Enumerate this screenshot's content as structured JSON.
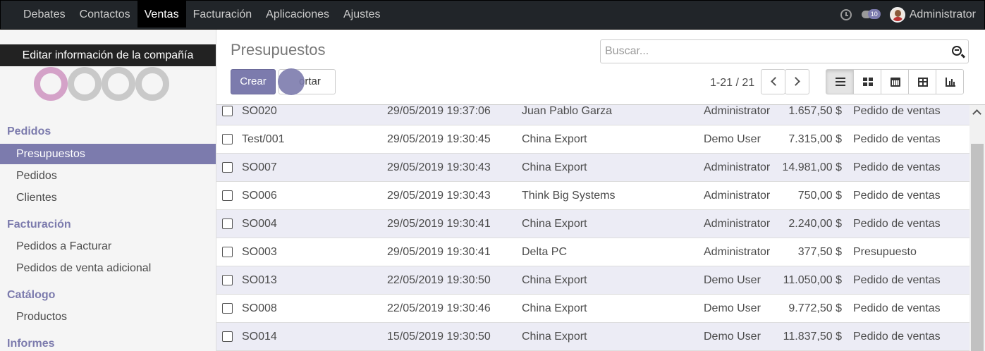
{
  "topbar": {
    "menu": [
      "Debates",
      "Contactos",
      "Ventas",
      "Facturación",
      "Aplicaciones",
      "Ajustes"
    ],
    "active_menu": "Ventas",
    "chat_badge": "10",
    "user_name": "Administrator"
  },
  "sidebar": {
    "tooltip": "Editar información de la compañía",
    "sections": [
      {
        "title": "Pedidos",
        "items": [
          "Presupuestos",
          "Pedidos",
          "Clientes"
        ]
      },
      {
        "title": "Facturación",
        "items": [
          "Pedidos a Facturar",
          "Pedidos de venta adicional"
        ]
      },
      {
        "title": "Catálogo",
        "items": [
          "Productos"
        ]
      },
      {
        "title": "Informes",
        "items": []
      }
    ],
    "active_item": "Presupuestos"
  },
  "control": {
    "title": "Presupuestos",
    "search_placeholder": "Buscar...",
    "create_label": "Crear",
    "import_label": "Importar",
    "import_visible": "ortar",
    "pager": "1-21 / 21"
  },
  "table": {
    "rows": [
      {
        "name": "SO020",
        "date": "29/05/2019 19:37:06",
        "customer": "Juan Pablo Garza",
        "salesperson": "Administrator",
        "total": "1.657,50 $",
        "state": "Pedido de ventas"
      },
      {
        "name": "Test/001",
        "date": "29/05/2019 19:30:45",
        "customer": "China Export",
        "salesperson": "Demo User",
        "total": "7.315,00 $",
        "state": "Pedido de ventas"
      },
      {
        "name": "SO007",
        "date": "29/05/2019 19:30:43",
        "customer": "China Export",
        "salesperson": "Administrator",
        "total": "14.981,00 $",
        "state": "Pedido de ventas"
      },
      {
        "name": "SO006",
        "date": "29/05/2019 19:30:43",
        "customer": "Think Big Systems",
        "salesperson": "Administrator",
        "total": "750,00 $",
        "state": "Pedido de ventas"
      },
      {
        "name": "SO004",
        "date": "29/05/2019 19:30:41",
        "customer": "China Export",
        "salesperson": "Administrator",
        "total": "2.240,00 $",
        "state": "Pedido de ventas"
      },
      {
        "name": "SO003",
        "date": "29/05/2019 19:30:41",
        "customer": "Delta PC",
        "salesperson": "Administrator",
        "total": "377,50 $",
        "state": "Presupuesto"
      },
      {
        "name": "SO013",
        "date": "22/05/2019 19:30:50",
        "customer": "China Export",
        "salesperson": "Demo User",
        "total": "11.050,00 $",
        "state": "Pedido de ventas"
      },
      {
        "name": "SO008",
        "date": "22/05/2019 19:30:46",
        "customer": "China Export",
        "salesperson": "Demo User",
        "total": "9.772,50 $",
        "state": "Pedido de ventas"
      },
      {
        "name": "SO014",
        "date": "15/05/2019 19:30:50",
        "customer": "China Export",
        "salesperson": "Demo User",
        "total": "11.837,50 $",
        "state": "Pedido de ventas"
      }
    ]
  },
  "colors": {
    "brand": "#7c7bad",
    "topbar": "#212529"
  },
  "icons": [
    "clock-icon",
    "chat-icon",
    "search-icon",
    "list-view-icon",
    "kanban-view-icon",
    "calendar-view-icon",
    "pivot-view-icon",
    "graph-view-icon"
  ]
}
